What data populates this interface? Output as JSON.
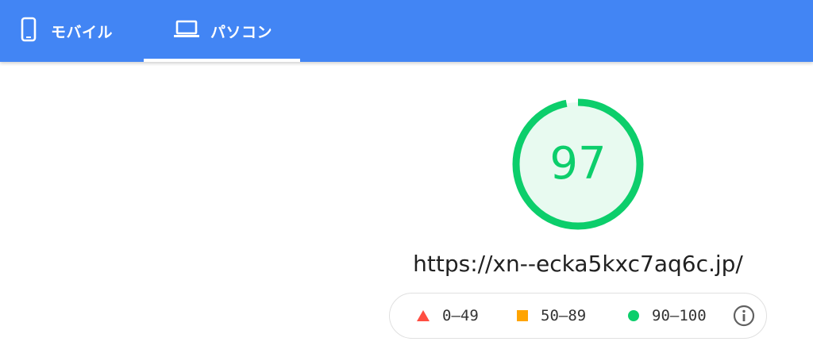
{
  "tabs": [
    {
      "label": "モバイル",
      "icon": "smartphone-icon",
      "selected": false
    },
    {
      "label": "パソコン",
      "icon": "laptop-icon",
      "selected": true
    }
  ],
  "report": {
    "score": "97",
    "score_fraction": 0.97,
    "url": "https://xn--ecka5kxc7aq6c.jp/"
  },
  "legend": {
    "items": [
      {
        "label": "0–49",
        "icon": "red-triangle-icon",
        "color": "#ff4e42"
      },
      {
        "label": "50–89",
        "icon": "orange-square-icon",
        "color": "#ffa400"
      },
      {
        "label": "90–100",
        "icon": "green-circle-icon",
        "color": "#0cce6b"
      }
    ],
    "info_icon": "info-icon"
  },
  "colors": {
    "header": "#4285f4",
    "pass": "#0cce6b",
    "pass_fill": "#e8faf0"
  }
}
